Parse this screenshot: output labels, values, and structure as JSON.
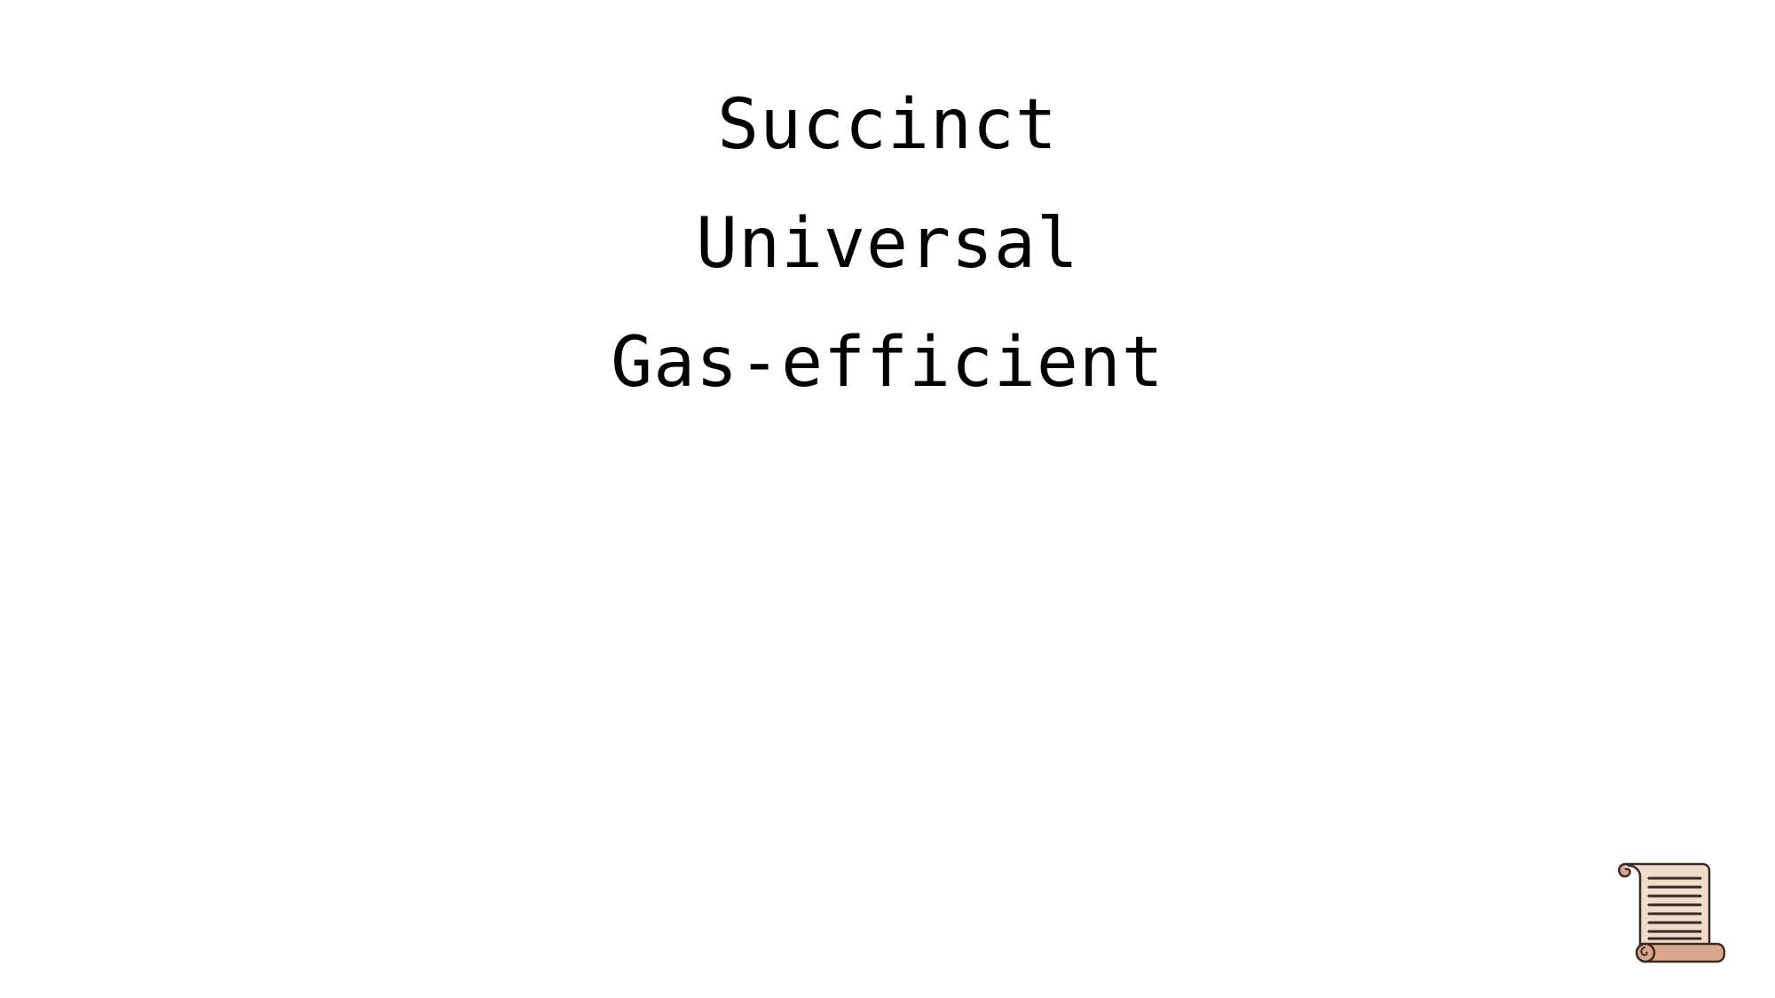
{
  "slide": {
    "lines": [
      "Succinct",
      "Universal",
      "Gas-efficient"
    ],
    "logo_icon": "scroll-icon"
  },
  "colors": {
    "background": "#ffffff",
    "text": "#000000",
    "scroll_paper": "#f0dcc8",
    "scroll_roll": "#d9a78c",
    "scroll_outline": "#3a2a22"
  }
}
